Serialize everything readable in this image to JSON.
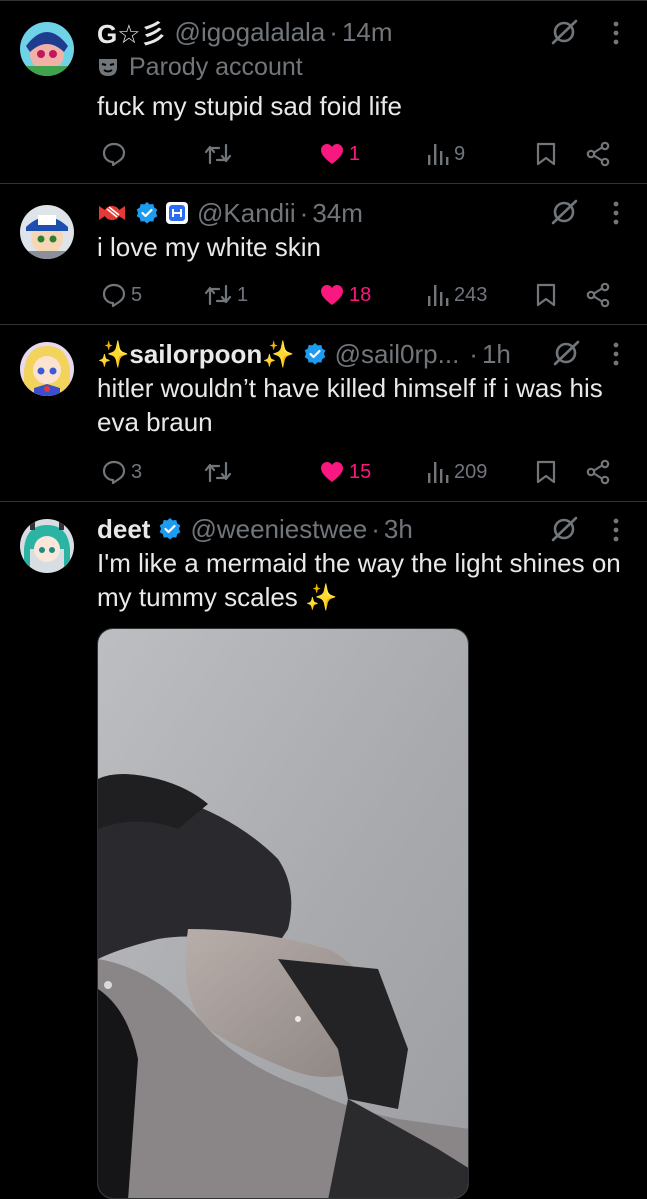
{
  "tweets": [
    {
      "name": "G☆彡",
      "handle": "@igogalalala",
      "time": "14m",
      "parody_label": "Parody account",
      "text": "fuck my stupid sad foid life",
      "replies": "",
      "retweets": "",
      "likes": "1",
      "views": "9",
      "liked": true
    },
    {
      "name": "",
      "handle": "@Kandii",
      "time": "34m",
      "text": "i love my white skin",
      "replies": "5",
      "retweets": "1",
      "likes": "18",
      "views": "243",
      "liked": true
    },
    {
      "name": "✨sailorpoon✨",
      "handle": "@sail0rp...",
      "time": "1h",
      "text": "hitler wouldn’t have killed himself if i was his eva braun",
      "replies": "3",
      "retweets": "",
      "likes": "15",
      "views": "209",
      "liked": true
    },
    {
      "name": "deet",
      "handle": "@weeniestwee",
      "time": "3h",
      "text": "I'm like a mermaid the way the light shines on my tummy scales ✨",
      "has_media": true
    }
  ],
  "colors": {
    "background": "#000000",
    "text": "#e7e9ea",
    "muted": "#71767b",
    "like": "#f91880",
    "verified": "#1d9bf0",
    "divider": "#2f3336"
  },
  "icons": [
    "reply-icon",
    "retweet-icon",
    "heart-icon",
    "views-icon",
    "bookmark-icon",
    "share-icon",
    "grok-icon",
    "more-icon",
    "verified-badge-icon"
  ]
}
